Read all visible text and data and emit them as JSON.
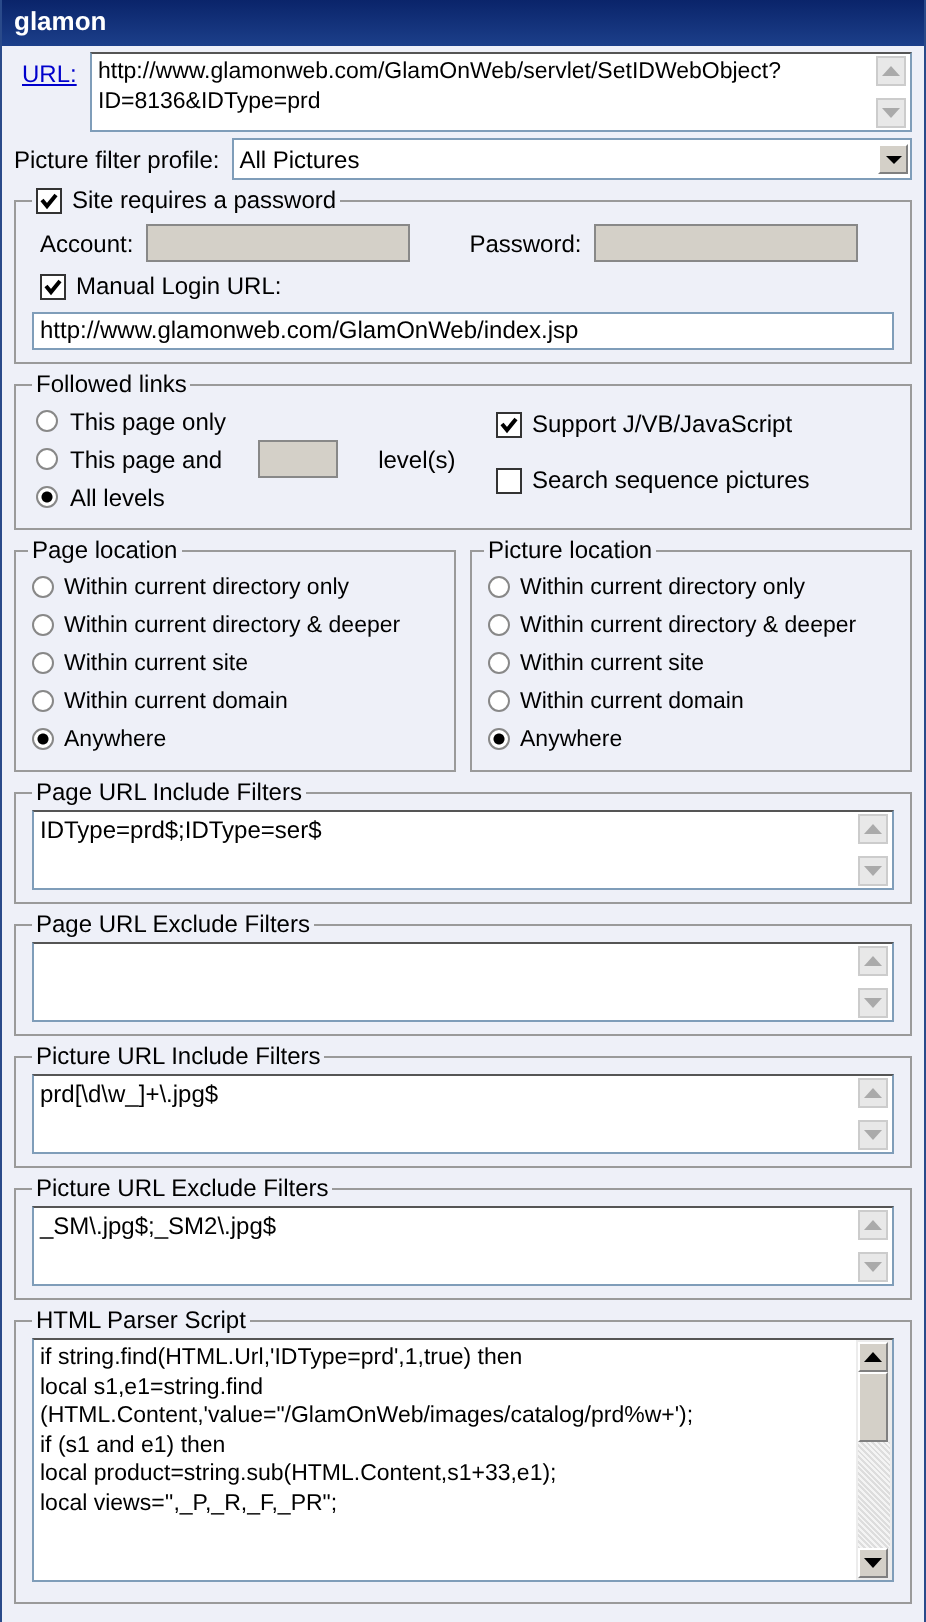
{
  "window": {
    "title": "glamon"
  },
  "url": {
    "label": "URL:",
    "lines": [
      "http://www.glamonweb.com/GlamOnWeb/servlet/SetIDWebObject?",
      "ID=8136&IDType=prd"
    ]
  },
  "picture_filter_profile": {
    "label": "Picture filter profile:",
    "value": "All Pictures"
  },
  "password": {
    "label": "Site requires a password",
    "checked": true,
    "account_label": "Account:",
    "password_label": "Password:",
    "manual_login": {
      "label": "Manual Login URL:",
      "checked": true
    },
    "login_url": "http://www.glamonweb.com/GlamOnWeb/index.jsp"
  },
  "followed_links": {
    "title": "Followed links",
    "options": [
      {
        "label": "This page only",
        "selected": false,
        "kind": "plain"
      },
      {
        "label": "This page and",
        "selected": false,
        "kind": "levels",
        "suffix": "level(s)"
      },
      {
        "label": "All levels",
        "selected": true,
        "kind": "plain"
      }
    ],
    "checkboxes": [
      {
        "label": "Support J/VB/JavaScript",
        "checked": true
      },
      {
        "label": "Search sequence pictures",
        "checked": false
      }
    ]
  },
  "locations": [
    {
      "title": "Page location",
      "options": [
        {
          "label": "Within current directory only",
          "selected": false
        },
        {
          "label": "Within current directory & deeper",
          "selected": false
        },
        {
          "label": "Within current site",
          "selected": false
        },
        {
          "label": "Within current domain",
          "selected": false
        },
        {
          "label": "Anywhere",
          "selected": true
        }
      ]
    },
    {
      "title": "Picture location",
      "options": [
        {
          "label": "Within current directory only",
          "selected": false
        },
        {
          "label": "Within current directory & deeper",
          "selected": false
        },
        {
          "label": "Within current site",
          "selected": false
        },
        {
          "label": "Within current domain",
          "selected": false
        },
        {
          "label": "Anywhere",
          "selected": true
        }
      ]
    }
  ],
  "filters": [
    {
      "title": "Page URL Include Filters",
      "value": "IDType=prd$;IDType=ser$"
    },
    {
      "title": "Page URL Exclude Filters"
    },
    {
      "title": "Picture URL Include Filters",
      "value": "prd[\\d\\w_]+\\.jpg$"
    },
    {
      "title": "Picture URL Exclude Filters",
      "value": "_SM\\.jpg$;_SM2\\.jpg$"
    }
  ],
  "parser_script": {
    "title": "HTML Parser Script",
    "lines": [
      "if string.find(HTML.Url,'IDType=prd',1,true) then",
      "local s1,e1=string.find",
      "(HTML.Content,'value=\"/GlamOnWeb/images/catalog/prd%w+');",
      "if (s1 and e1) then",
      "local product=string.sub(HTML.Content,s1+33,e1);",
      "local views='',_P,_R,_F,_PR\";"
    ]
  }
}
